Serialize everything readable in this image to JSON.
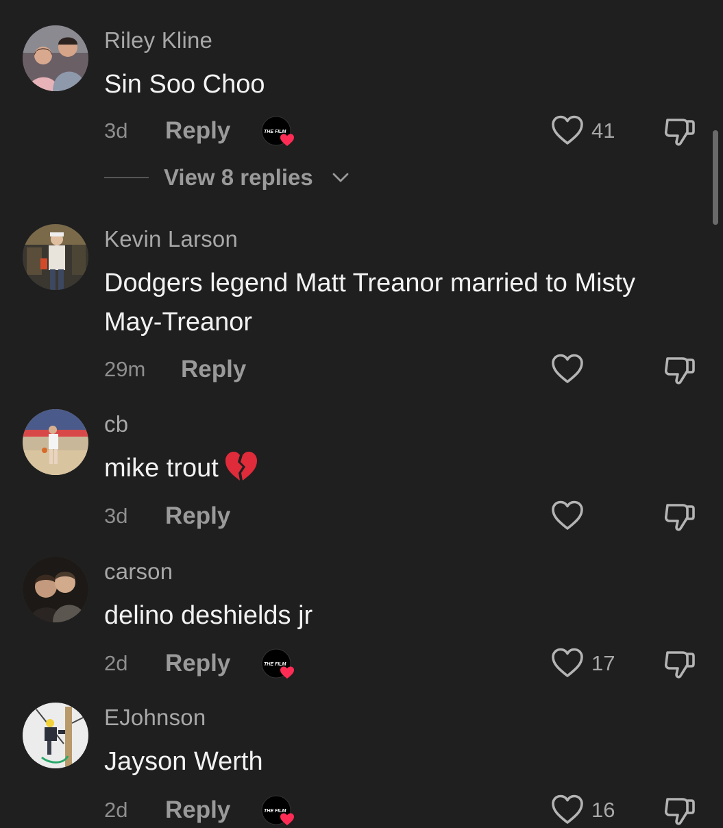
{
  "comments": [
    {
      "username": "Riley Kline",
      "text": "Sin Soo Choo",
      "time": "3d",
      "reply_label": "Reply",
      "creator_liked": true,
      "likes": "41",
      "view_replies": "View 8 replies"
    },
    {
      "username": "Kevin Larson",
      "text": "Dodgers legend Matt Treanor married to Misty May-Treanor",
      "time": "29m",
      "reply_label": "Reply",
      "creator_liked": false,
      "likes": ""
    },
    {
      "username": "cb",
      "text": "mike trout",
      "emoji": "broken-heart",
      "time": "3d",
      "reply_label": "Reply",
      "creator_liked": false,
      "likes": ""
    },
    {
      "username": "carson",
      "text": "delino deshields jr",
      "time": "2d",
      "reply_label": "Reply",
      "creator_liked": true,
      "likes": "17"
    },
    {
      "username": "EJohnson",
      "text": "Jayson Werth",
      "time": "2d",
      "reply_label": "Reply",
      "creator_liked": true,
      "likes": "16"
    }
  ],
  "creator_badge_text": "THE FILM",
  "icons": {
    "like": "heart-outline-icon",
    "dislike": "thumbs-down-outline-icon",
    "creator_badge": "creator-liked-badge-icon",
    "chevron": "chevron-down-icon"
  },
  "colors": {
    "background": "#1f1f1f",
    "username": "#a8a8a8",
    "text": "#f2f2f2",
    "meta": "#8e8e8e",
    "heart_badge": "#fe2c55"
  }
}
